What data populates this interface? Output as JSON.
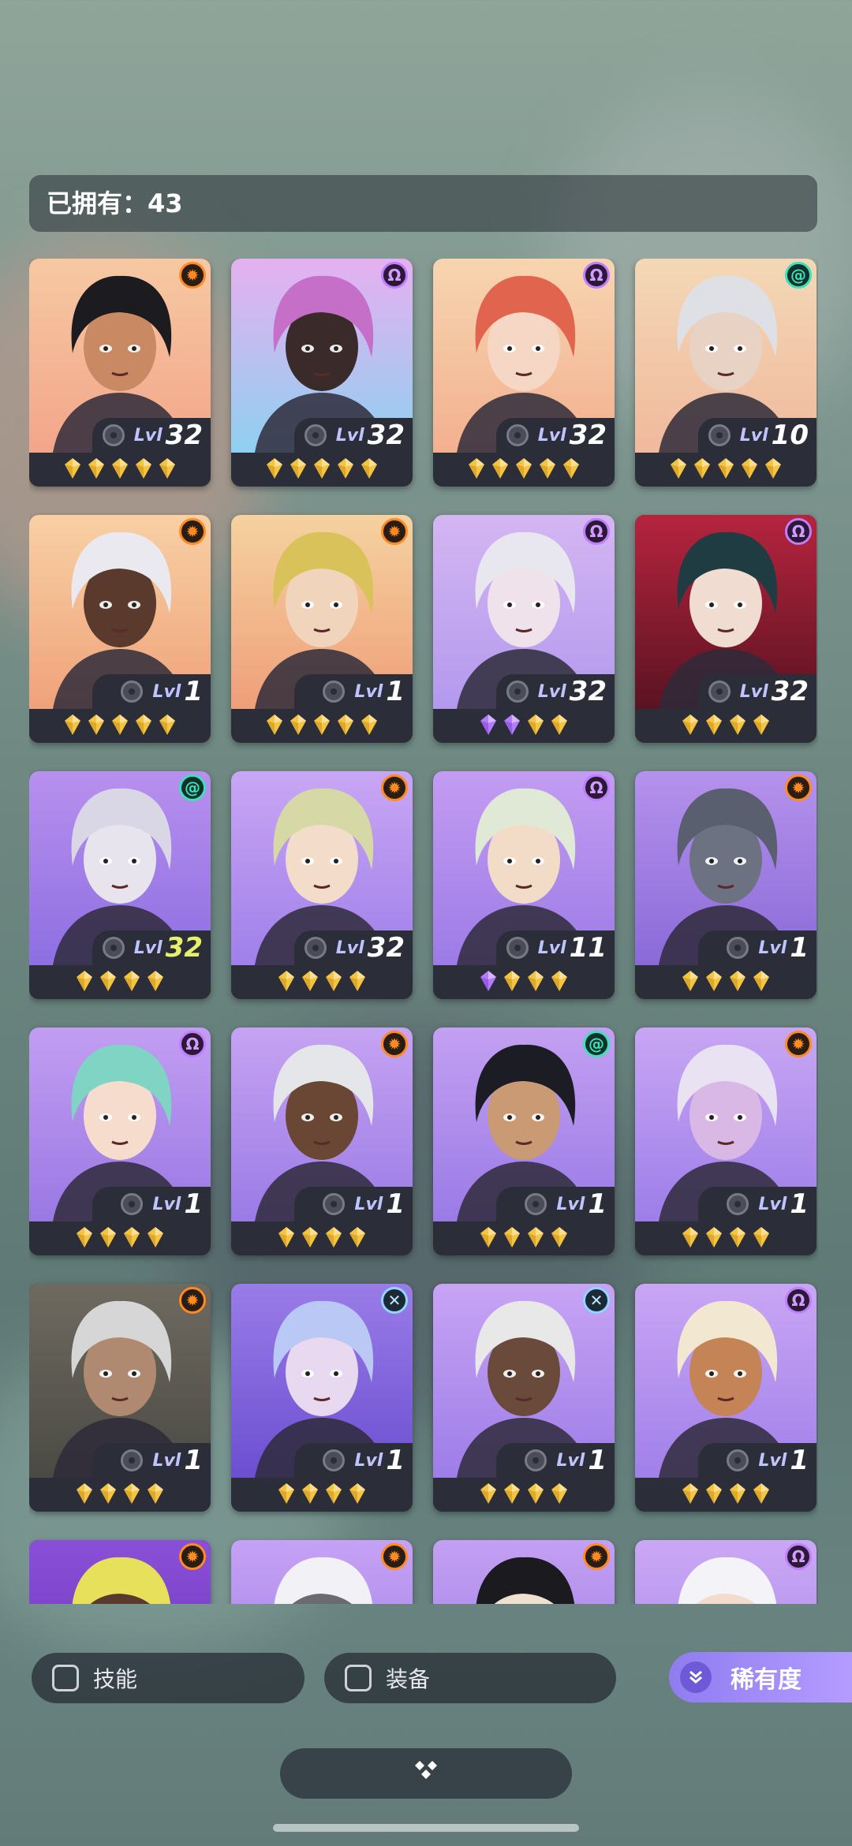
{
  "header": {
    "owned_label": "已拥有：43"
  },
  "colors": {
    "sun_faction": "#ff8a22",
    "omega_faction": "#c27cff",
    "spiral_faction": "#3ee0b8",
    "cross_faction": "#8ed6ff",
    "gold_star": "#f5c542",
    "purple_star": "#b57bff",
    "level_highlight": "#e6f06a",
    "accent": "#9b86f5"
  },
  "heroes": [
    {
      "level_prefix": "Lvl",
      "level": "32",
      "faction": "sun",
      "stars": [
        "gold",
        "gold",
        "gold",
        "gold",
        "gold"
      ],
      "bg": [
        "#f6c9a3",
        "#f3a58a"
      ],
      "hair": "#1c1b1f",
      "skin": "#c98a63"
    },
    {
      "level_prefix": "Lvl",
      "level": "32",
      "faction": "omega",
      "stars": [
        "gold",
        "gold",
        "gold",
        "gold",
        "gold"
      ],
      "bg": [
        "#e6b0f0",
        "#8fd0f0"
      ],
      "hair": "#c66fc9",
      "skin": "#3a2a2a"
    },
    {
      "level_prefix": "Lvl",
      "level": "32",
      "faction": "omega",
      "stars": [
        "gold",
        "gold",
        "gold",
        "gold",
        "gold"
      ],
      "bg": [
        "#f7d5b0",
        "#f3b08f"
      ],
      "hair": "#e0644e",
      "skin": "#f6d6c4"
    },
    {
      "level_prefix": "Lvl",
      "level": "10",
      "faction": "spiral",
      "stars": [
        "gold",
        "gold",
        "gold",
        "gold",
        "gold"
      ],
      "bg": [
        "#f3d8b6",
        "#f1b99d"
      ],
      "hair": "#dfe0e6",
      "skin": "#e8d2c3"
    },
    {
      "level_prefix": "Lvl",
      "level": "1",
      "faction": "sun",
      "stars": [
        "gold",
        "gold",
        "gold",
        "gold",
        "gold"
      ],
      "bg": [
        "#f8d0a4",
        "#f0a27a"
      ],
      "hair": "#e9e9ef",
      "skin": "#5a3a2c"
    },
    {
      "level_prefix": "Lvl",
      "level": "1",
      "faction": "sun",
      "stars": [
        "gold",
        "gold",
        "gold",
        "gold",
        "gold"
      ],
      "bg": [
        "#f5d2a0",
        "#ef9f78"
      ],
      "hair": "#d8c259",
      "skin": "#f0d4bc"
    },
    {
      "level_prefix": "Lvl",
      "level": "32",
      "faction": "omega",
      "stars": [
        "purple",
        "purple",
        "gold",
        "gold"
      ],
      "bg": [
        "#d4b6f2",
        "#b399ee"
      ],
      "hair": "#e8e6ee",
      "skin": "#efe2ea"
    },
    {
      "level_prefix": "Lvl",
      "level": "32",
      "faction": "omega",
      "stars": [
        "gold",
        "gold",
        "gold",
        "gold"
      ],
      "bg": [
        "#b6243e",
        "#5a1322"
      ],
      "hair": "#1f3c42",
      "skin": "#f0dcd0"
    },
    {
      "level_prefix": "Lvl",
      "level": "32",
      "faction": "spiral",
      "stars": [
        "gold",
        "gold",
        "gold",
        "gold"
      ],
      "bg": [
        "#b890ee",
        "#8d6fe2"
      ],
      "hair": "#d9d6e6",
      "skin": "#e8e4ee",
      "level_highlight": true
    },
    {
      "level_prefix": "Lvl",
      "level": "32",
      "faction": "sun",
      "stars": [
        "gold",
        "gold",
        "gold",
        "gold"
      ],
      "bg": [
        "#c9a6f4",
        "#9f80ea"
      ],
      "hair": "#d6d8a6",
      "skin": "#f4dcca"
    },
    {
      "level_prefix": "Lvl",
      "level": "11",
      "faction": "omega",
      "stars": [
        "purple",
        "gold",
        "gold",
        "gold"
      ],
      "bg": [
        "#c39cf2",
        "#9c7be6"
      ],
      "hair": "#dfe9d6",
      "skin": "#f2dcc8"
    },
    {
      "level_prefix": "Lvl",
      "level": "1",
      "faction": "sun",
      "stars": [
        "gold",
        "gold",
        "gold",
        "gold"
      ],
      "bg": [
        "#b592ec",
        "#8a6ad8"
      ],
      "hair": "#5a5f70",
      "skin": "#6c7282"
    },
    {
      "level_prefix": "Lvl",
      "level": "1",
      "faction": "omega",
      "stars": [
        "gold",
        "gold",
        "gold",
        "gold"
      ],
      "bg": [
        "#c29ef2",
        "#9a78e4"
      ],
      "hair": "#7fd4c4",
      "skin": "#f6dccd"
    },
    {
      "level_prefix": "Lvl",
      "level": "1",
      "faction": "sun",
      "stars": [
        "gold",
        "gold",
        "gold",
        "gold"
      ],
      "bg": [
        "#c6a3f2",
        "#9a7be6"
      ],
      "hair": "#e4e6ea",
      "skin": "#6a4634"
    },
    {
      "level_prefix": "Lvl",
      "level": "1",
      "faction": "spiral",
      "stars": [
        "gold",
        "gold",
        "gold",
        "gold"
      ],
      "bg": [
        "#c3a0f2",
        "#9a7ae6"
      ],
      "hair": "#1c1c24",
      "skin": "#c99a74"
    },
    {
      "level_prefix": "Lvl",
      "level": "1",
      "faction": "sun",
      "stars": [
        "gold",
        "gold",
        "gold",
        "gold"
      ],
      "bg": [
        "#c8a6f4",
        "#9d7ee8"
      ],
      "hair": "#e8e2f2",
      "skin": "#d9b8e6"
    },
    {
      "level_prefix": "Lvl",
      "level": "1",
      "faction": "sun",
      "stars": [
        "gold",
        "gold",
        "gold",
        "gold"
      ],
      "bg": [
        "#6f6a60",
        "#4a4a44"
      ],
      "hair": "#d6d6d6",
      "skin": "#b08a70"
    },
    {
      "level_prefix": "Lvl",
      "level": "1",
      "faction": "cross",
      "stars": [
        "gold",
        "gold",
        "gold",
        "gold"
      ],
      "bg": [
        "#9a7ce8",
        "#6b4fd0"
      ],
      "hair": "#b9c8f4",
      "skin": "#e8d8f0"
    },
    {
      "level_prefix": "Lvl",
      "level": "1",
      "faction": "cross",
      "stars": [
        "gold",
        "gold",
        "gold",
        "gold"
      ],
      "bg": [
        "#c7a4f4",
        "#9d7de8"
      ],
      "hair": "#e8e8e8",
      "skin": "#6a4a3a"
    },
    {
      "level_prefix": "Lvl",
      "level": "1",
      "faction": "omega",
      "stars": [
        "gold",
        "gold",
        "gold",
        "gold"
      ],
      "bg": [
        "#c9a6f4",
        "#a080ea"
      ],
      "hair": "#f2e8d2",
      "skin": "#c48456"
    },
    {
      "faction": "sun",
      "bg": [
        "#8a4fd8",
        "#6a36b8"
      ],
      "hair": "#e6e05a",
      "skin": "#5a3a2c"
    },
    {
      "faction": "sun",
      "bg": [
        "#c5a2f4",
        "#9c7ce8"
      ],
      "hair": "#f2f2f6",
      "skin": "#6a6a70"
    },
    {
      "faction": "sun",
      "bg": [
        "#c3a0f2",
        "#9a7ae6"
      ],
      "hair": "#1a1a1f",
      "skin": "#f0e0d0"
    },
    {
      "faction": "omega",
      "bg": [
        "#cba8f4",
        "#a182ea"
      ],
      "hair": "#f4f4f8",
      "skin": "#f4dccd"
    }
  ],
  "filters": {
    "skill_label": "技能",
    "equipment_label": "装备",
    "rarity_label": "稀有度"
  },
  "icons": {
    "sun": "sun-faction-icon",
    "omega": "omega-faction-icon",
    "spiral": "spiral-faction-icon",
    "cross": "cross-faction-icon",
    "gear": "gear-icon",
    "gem": "gem-star-icon",
    "chevron": "double-chevron-down-icon",
    "collapse": "diamond-cluster-icon"
  }
}
